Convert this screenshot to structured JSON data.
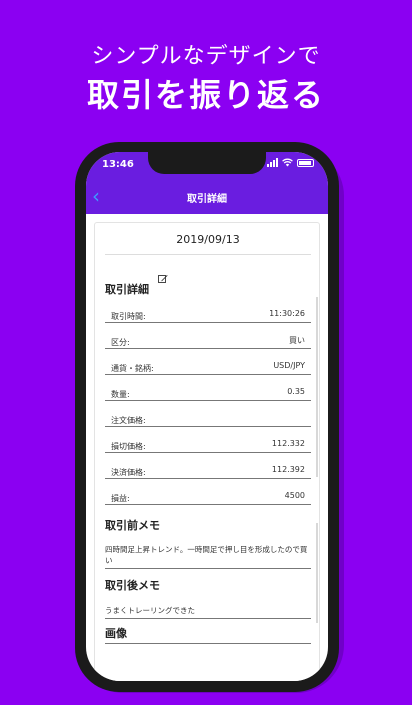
{
  "promo": {
    "subtitle": "シンプルなデザインで",
    "title": "取引を振り返る"
  },
  "status_bar": {
    "time": "13:46"
  },
  "nav": {
    "back_icon": "chevron-left-icon",
    "title": "取引詳細"
  },
  "detail": {
    "date": "2019/09/13",
    "section_title": "取引詳細",
    "rows": [
      {
        "label": "取引時間:",
        "value": "11:30:26"
      },
      {
        "label": "区分:",
        "value": "買い"
      },
      {
        "label": "通貨・銘柄:",
        "value": "USD/JPY"
      },
      {
        "label": "数量:",
        "value": "0.35"
      },
      {
        "label": "注文価格:",
        "value": ""
      },
      {
        "label": "損切価格:",
        "value": "112.332"
      },
      {
        "label": "決済価格:",
        "value": "112.392"
      },
      {
        "label": "損益:",
        "value": "4500"
      }
    ],
    "pre_memo_title": "取引前メモ",
    "pre_memo": "四時間足上昇トレンド。一時間足で押し目を形成したので買い",
    "post_memo_title": "取引後メモ",
    "post_memo": "うまくトレーリングできた",
    "image_title": "画像"
  },
  "colors": {
    "background": "#8B00F2",
    "nav": "#6a1de0",
    "back_accent": "#3d9bff"
  }
}
